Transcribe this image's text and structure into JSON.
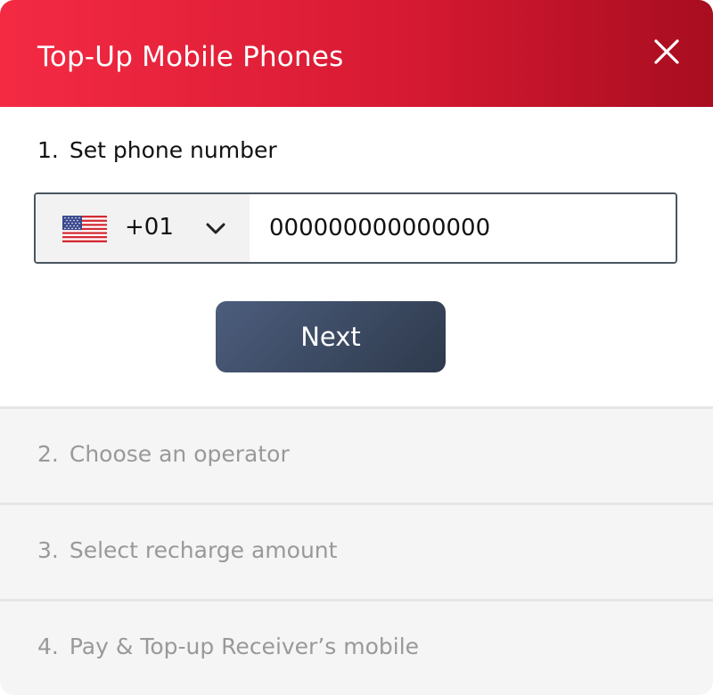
{
  "header": {
    "title": "Top-Up Mobile Phones",
    "close_icon": "close-icon",
    "gradient": [
      "#f42a43",
      "#d81a33",
      "#a80d20"
    ]
  },
  "step1": {
    "number": "1.",
    "title": "Set phone number",
    "country": {
      "flag_icon": "us-flag-icon",
      "dial_code": "+01",
      "dropdown_icon": "chevron-down-icon"
    },
    "phone_value": "000000000000000",
    "next_label": "Next",
    "next_colors": [
      "#4c5d7d",
      "#2e3a4c"
    ]
  },
  "steps": [
    {
      "number": "2.",
      "label": "Choose an operator"
    },
    {
      "number": "3.",
      "label": "Select recharge amount"
    },
    {
      "number": "4.",
      "label": "Pay & Top-up Receiver’s mobile"
    }
  ]
}
